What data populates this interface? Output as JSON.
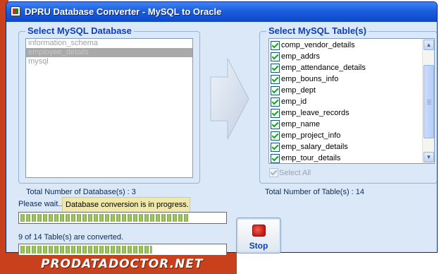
{
  "window": {
    "title": "DPRU Database Converter - MySQL to Oracle"
  },
  "databases": {
    "legend": "Select MySQL Database",
    "items": [
      "information_schema",
      "employee_details",
      "mysql"
    ],
    "selected_index": 1,
    "total_label": "Total Number of Database(s) : 3"
  },
  "tables": {
    "legend": "Select MySQL Table(s)",
    "items": [
      "comp_vendor_details",
      "emp_addrs",
      "emp_attendance_details",
      "emp_bouns_info",
      "emp_dept",
      "emp_id",
      "emp_leave_records",
      "emp_name",
      "emp_project_info",
      "emp_salary_details",
      "emp_tour_details"
    ],
    "select_all_label": "Select All",
    "total_label": "Total Number of Table(s) : 14"
  },
  "status": {
    "please_wait": "Please wait...",
    "tooltip": "Database conversion is in progress.",
    "converted_label": "9 of 14 Table(s) are converted.",
    "progress1_fraction": 0.82,
    "progress2_fraction": 0.64
  },
  "stop_button": {
    "label": "Stop"
  },
  "watermark": "PRODATADOCTOR.NET"
}
